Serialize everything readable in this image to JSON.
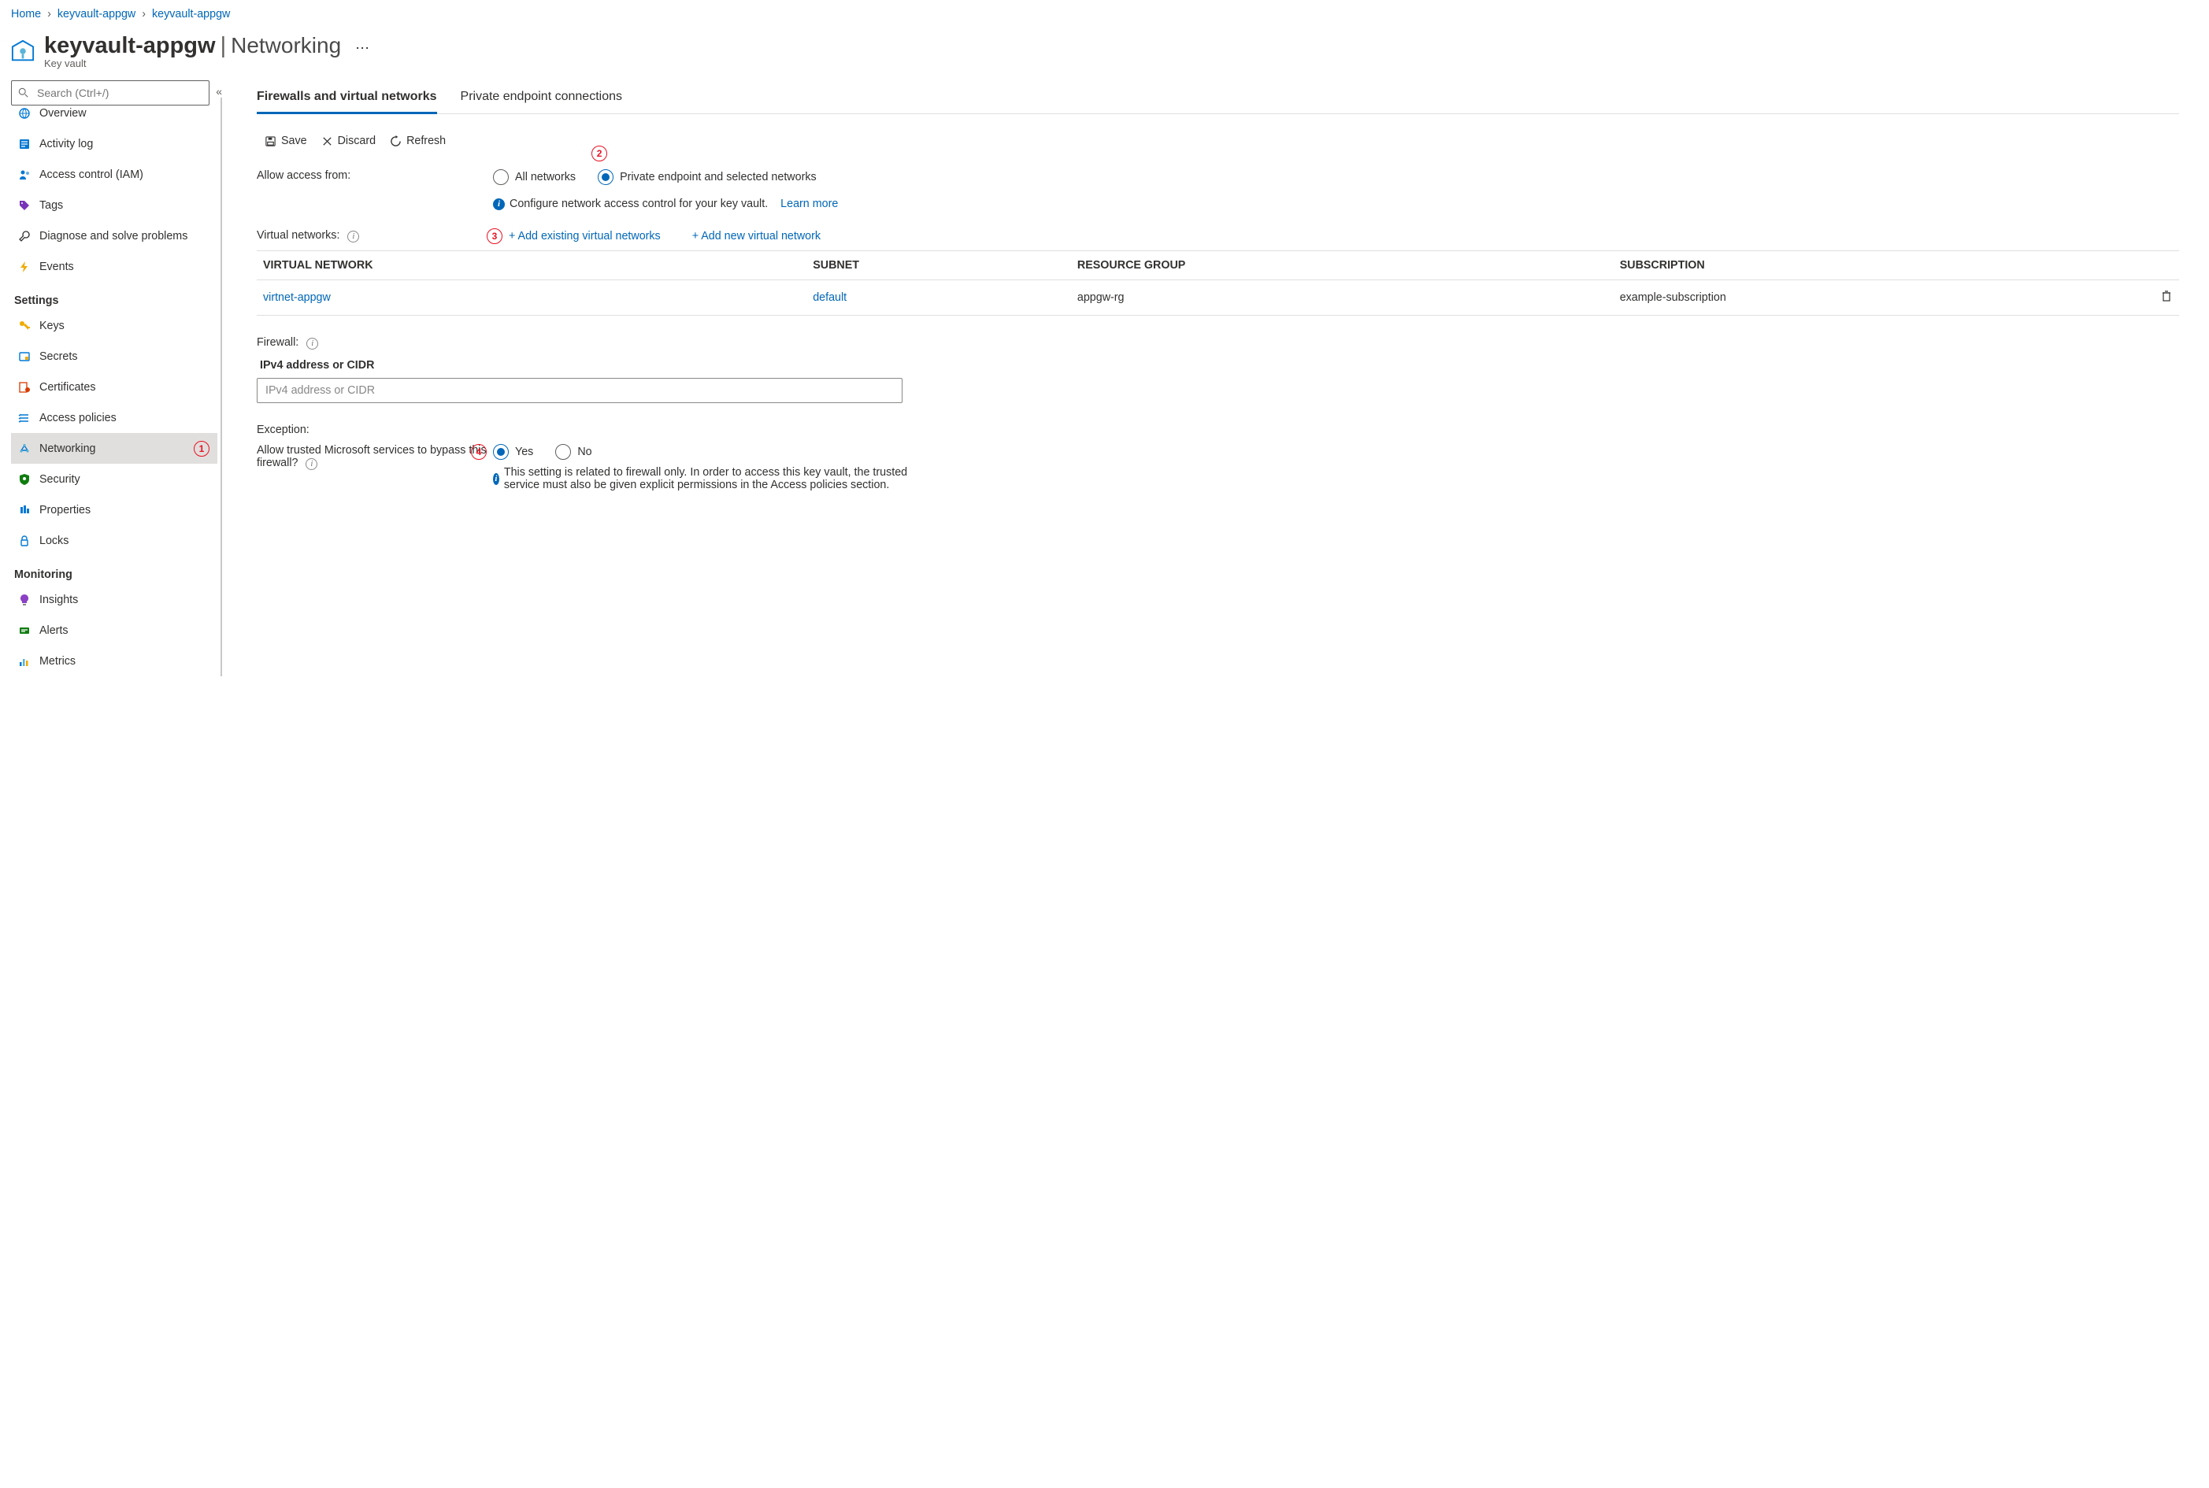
{
  "breadcrumb": [
    {
      "label": "Home",
      "current": false
    },
    {
      "label": "keyvault-appgw",
      "current": false
    },
    {
      "label": "keyvault-appgw",
      "current": true
    }
  ],
  "header": {
    "title": "keyvault-appgw",
    "section": "Networking",
    "subtype": "Key vault"
  },
  "search": {
    "placeholder": "Search (Ctrl+/)"
  },
  "nav": [
    {
      "icon": "globe",
      "label": "Overview",
      "color": "#0078d4"
    },
    {
      "icon": "activity",
      "label": "Activity log",
      "color": "#0078d4"
    },
    {
      "icon": "iam",
      "label": "Access control (IAM)",
      "color": "#0078d4"
    },
    {
      "icon": "tag",
      "label": "Tags",
      "color": "#7734b7"
    },
    {
      "icon": "wrench",
      "label": "Diagnose and solve problems",
      "color": "#323130"
    },
    {
      "icon": "bolt",
      "label": "Events",
      "color": "#f0ab00"
    }
  ],
  "nav_settings": [
    {
      "icon": "key",
      "label": "Keys",
      "color": "#f0ab00"
    },
    {
      "icon": "secret",
      "label": "Secrets",
      "color": "#0078d4"
    },
    {
      "icon": "cert",
      "label": "Certificates",
      "color": "#d83b01"
    },
    {
      "icon": "policies",
      "label": "Access policies",
      "color": "#0078d4"
    },
    {
      "icon": "network",
      "label": "Networking",
      "color": "#0078d4",
      "selected": true,
      "callout": "1"
    },
    {
      "icon": "shield",
      "label": "Security",
      "color": "#107c10"
    },
    {
      "icon": "props",
      "label": "Properties",
      "color": "#0078d4"
    },
    {
      "icon": "lock",
      "label": "Locks",
      "color": "#0078d4"
    }
  ],
  "nav_monitoring": [
    {
      "icon": "bulb",
      "label": "Insights",
      "color": "#8a41c4"
    },
    {
      "icon": "alert",
      "label": "Alerts",
      "color": "#107c10"
    },
    {
      "icon": "metrics",
      "label": "Metrics",
      "color": "#0078d4"
    }
  ],
  "nav_sections": {
    "settings": "Settings",
    "monitoring": "Monitoring"
  },
  "tabs": {
    "active": "Firewalls and virtual networks",
    "other": "Private endpoint connections"
  },
  "toolbar": {
    "save": "Save",
    "discard": "Discard",
    "refresh": "Refresh"
  },
  "networking": {
    "access_label": "Allow access from:",
    "radio_all": "All networks",
    "radio_private": "Private endpoint and selected networks",
    "callout2": "2",
    "info_text": "Configure network access control for your key vault.",
    "learn_more": "Learn more",
    "vnet_label": "Virtual networks:",
    "callout3": "3",
    "add_existing": "+ Add existing virtual networks",
    "add_new": "+ Add new virtual network",
    "table": {
      "headers": [
        "VIRTUAL NETWORK",
        "SUBNET",
        "RESOURCE GROUP",
        "SUBSCRIPTION"
      ],
      "row": {
        "vnet": "virtnet-appgw",
        "subnet": "default",
        "rg": "appgw-rg",
        "sub": "example-subscription"
      }
    },
    "firewall_label": "Firewall:",
    "cidr_header": "IPv4 address or CIDR",
    "cidr_placeholder": "IPv4 address or CIDR",
    "exception_label": "Exception:",
    "bypass_label": "Allow trusted Microsoft services to bypass this firewall?",
    "callout4": "4",
    "yes": "Yes",
    "no": "No",
    "bypass_info": "This setting is related to firewall only. In order to access this key vault, the trusted service must also be given explicit permissions in the Access policies section."
  }
}
